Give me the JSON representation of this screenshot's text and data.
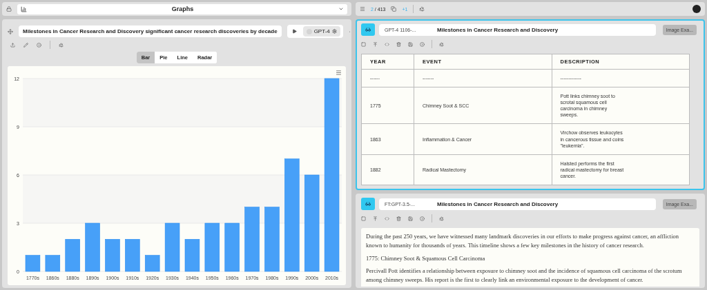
{
  "left_bar": {
    "title": "Graphs"
  },
  "graph_panel": {
    "title": "Milestones in Cancer Research and Discovery significant cancer research discoveries by decade",
    "model": "GPT-4",
    "chart_types": [
      {
        "label": "Bar",
        "selected": true
      },
      {
        "label": "Pie",
        "selected": false
      },
      {
        "label": "Line",
        "selected": false
      },
      {
        "label": "Radar",
        "selected": false
      }
    ],
    "chart_data": {
      "type": "bar",
      "categories": [
        "1770s",
        "1860s",
        "1880s",
        "1890s",
        "1900s",
        "1910s",
        "1920s",
        "1930s",
        "1940s",
        "1950s",
        "1960s",
        "1970s",
        "1980s",
        "1990s",
        "2000s",
        "2010s"
      ],
      "series": [
        {
          "color": "#47a0f8",
          "values": [
            1,
            1,
            2,
            3,
            2,
            2,
            1,
            3,
            2,
            3,
            3,
            4,
            4,
            7,
            6,
            12
          ]
        }
      ],
      "grid": true,
      "ylim": [
        0,
        12
      ],
      "yticks": [
        0,
        3,
        6,
        9,
        12
      ]
    }
  },
  "right_bar": {
    "current": "2",
    "total": "/ 413",
    "delta": "+1"
  },
  "responses": [
    {
      "kind": "table",
      "model": "GPT-4 1106-...",
      "title": "Milestones in Cancer Research and Discovery",
      "button": "Image Exa...",
      "selected": true,
      "columns": [
        "YEAR",
        "EVENT",
        "DESCRIPTION"
      ],
      "rows": [
        [
          "------",
          "-------",
          "-------------"
        ],
        [
          "1775",
          "Chimney Soot & SCC",
          "Pott links chimney soot to scrotal squamous cell carcinoma in chimney sweeps."
        ],
        [
          "1863",
          "Inflammation & Cancer",
          "Virchow observes leukocytes in cancerous tissue and coins \"leukemia\"."
        ],
        [
          "1882",
          "Radical Mastectomy",
          "Halsted performs the first radical mastectomy for breast cancer."
        ]
      ]
    },
    {
      "kind": "text",
      "model": "FT:GPT-3.5-...",
      "title": "Milestones in Cancer Research and Discovery",
      "button": "Image Exa...",
      "selected": false,
      "paragraphs": [
        "During the past 250 years, we have witnessed many landmark discoveries in our efforts to make progress against cancer, an affliction known to humanity for thousands of years. This timeline shows a few key milestones in the history of cancer research.",
        "1775: Chimney Soot & Squamous Cell Carcinoma",
        "Percivall Pott identifies a relationship between exposure to chimney soot and the incidence of squamous cell carcinoma of the scrotum among chimney sweeps. His report is the first to clearly link an environmental exposure to the development of cancer."
      ]
    }
  ]
}
